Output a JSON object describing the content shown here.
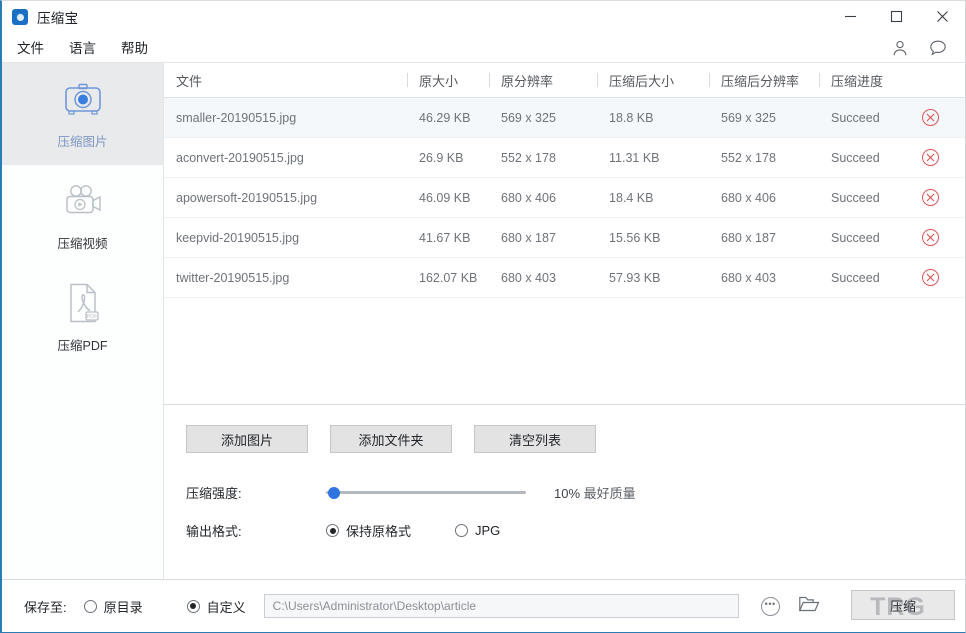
{
  "window": {
    "title": "压缩宝",
    "app_icon": "camera-lens-icon",
    "minimize": "—",
    "maximize": "▢",
    "close": "✕"
  },
  "menubar": {
    "items": [
      {
        "label": "文件"
      },
      {
        "label": "语言"
      },
      {
        "label": "帮助"
      }
    ],
    "account_icon": "user-icon",
    "feedback_icon": "chat-bubble-icon"
  },
  "sidebar": {
    "items": [
      {
        "label": "压缩图片",
        "icon": "camera-icon",
        "active": true
      },
      {
        "label": "压缩视频",
        "icon": "video-camera-icon",
        "active": false
      },
      {
        "label": "压缩PDF",
        "icon": "pdf-file-icon",
        "active": false
      }
    ]
  },
  "table": {
    "headers": {
      "file": "文件",
      "original_size": "原大小",
      "original_resolution": "原分辨率",
      "compressed_size": "压缩后大小",
      "compressed_resolution": "压缩后分辨率",
      "progress": "压缩进度"
    },
    "rows": [
      {
        "file": "smaller-20190515.jpg",
        "original_size": "46.29 KB",
        "original_resolution": "569 x 325",
        "compressed_size": "18.8 KB",
        "compressed_resolution": "569 x 325",
        "progress": "Succeed",
        "selected": true
      },
      {
        "file": "aconvert-20190515.jpg",
        "original_size": "26.9 KB",
        "original_resolution": "552 x 178",
        "compressed_size": "11.31 KB",
        "compressed_resolution": "552 x 178",
        "progress": "Succeed",
        "selected": false
      },
      {
        "file": "apowersoft-20190515.jpg",
        "original_size": "46.09 KB",
        "original_resolution": "680 x 406",
        "compressed_size": "18.4 KB",
        "compressed_resolution": "680 x 406",
        "progress": "Succeed",
        "selected": false
      },
      {
        "file": "keepvid-20190515.jpg",
        "original_size": "41.67 KB",
        "original_resolution": "680 x 187",
        "compressed_size": "15.56 KB",
        "compressed_resolution": "680 x 187",
        "progress": "Succeed",
        "selected": false
      },
      {
        "file": "twitter-20190515.jpg",
        "original_size": "162.07 KB",
        "original_resolution": "680 x 403",
        "compressed_size": "57.93 KB",
        "compressed_resolution": "680 x 403",
        "progress": "Succeed",
        "selected": false
      }
    ],
    "delete_icon": "circle-x-icon"
  },
  "controls": {
    "add_images": "添加图片",
    "add_folder": "添加文件夹",
    "clear_list": "清空列表",
    "strength_label": "压缩强度:",
    "strength_percent": "10%",
    "strength_quality": "最好质量",
    "strength_value": 10,
    "format_label": "输出格式:",
    "format_options": [
      {
        "label": "保持原格式",
        "selected": true
      },
      {
        "label": "JPG",
        "selected": false
      }
    ]
  },
  "footer": {
    "save_label": "保存至:",
    "save_options": [
      {
        "label": "原目录",
        "selected": false
      },
      {
        "label": "自定义",
        "selected": true
      }
    ],
    "path_value": "C:\\Users\\Administrator\\Desktop\\article",
    "more_icon": "ellipsis-circle-icon",
    "browse_icon": "open-folder-icon",
    "compress_button": "压缩",
    "watermark": "TRG"
  },
  "colors": {
    "accent": "#2f74e0",
    "window_border": "#2b7cb3",
    "delete": "#d95555",
    "selected_row": "#f4f8fb",
    "active_sidebar": "#e9eaec"
  }
}
